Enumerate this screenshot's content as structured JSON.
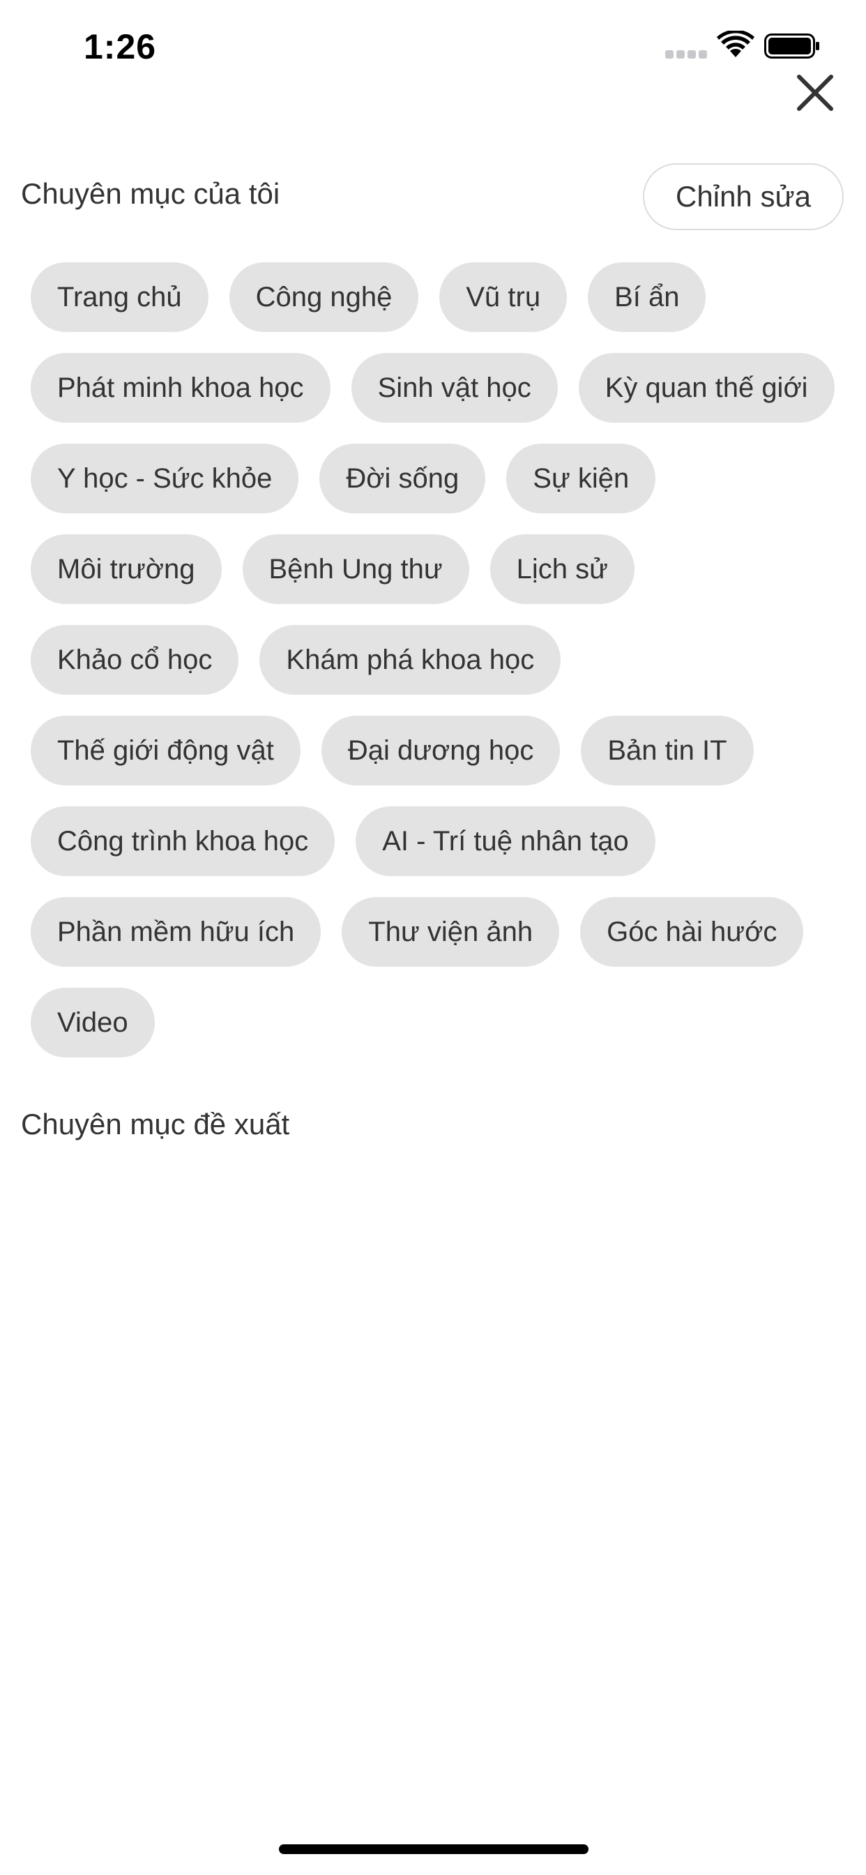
{
  "status_bar": {
    "time": "1:26",
    "signal_icon": "cellular-signal-icon",
    "wifi_icon": "wifi-icon",
    "battery_icon": "battery-icon"
  },
  "header": {
    "close_icon": "close-icon"
  },
  "my_categories": {
    "title": "Chuyên mục của tôi",
    "edit_label": "Chỉnh sửa",
    "items": [
      "Trang chủ",
      "Công nghệ",
      "Vũ trụ",
      "Bí ẩn",
      "Phát minh khoa học",
      "Sinh vật học",
      "Kỳ quan thế giới",
      "Y học - Sức khỏe",
      "Đời sống",
      "Sự kiện",
      "Môi trường",
      "Bệnh Ung thư",
      "Lịch sử",
      "Khảo cổ học",
      "Khám phá khoa học",
      "Thế giới động vật",
      "Đại dương học",
      "Bản tin IT",
      "Công trình khoa học",
      "AI - Trí tuệ nhân tạo",
      "Phần mềm hữu ích",
      "Thư viện ảnh",
      "Góc hài hước",
      "Video"
    ]
  },
  "suggested_categories": {
    "title": "Chuyên mục đề xuất"
  },
  "colors": {
    "chip_background": "#e3e3e3",
    "text": "#333333",
    "edit_border": "#dcdcdc"
  }
}
